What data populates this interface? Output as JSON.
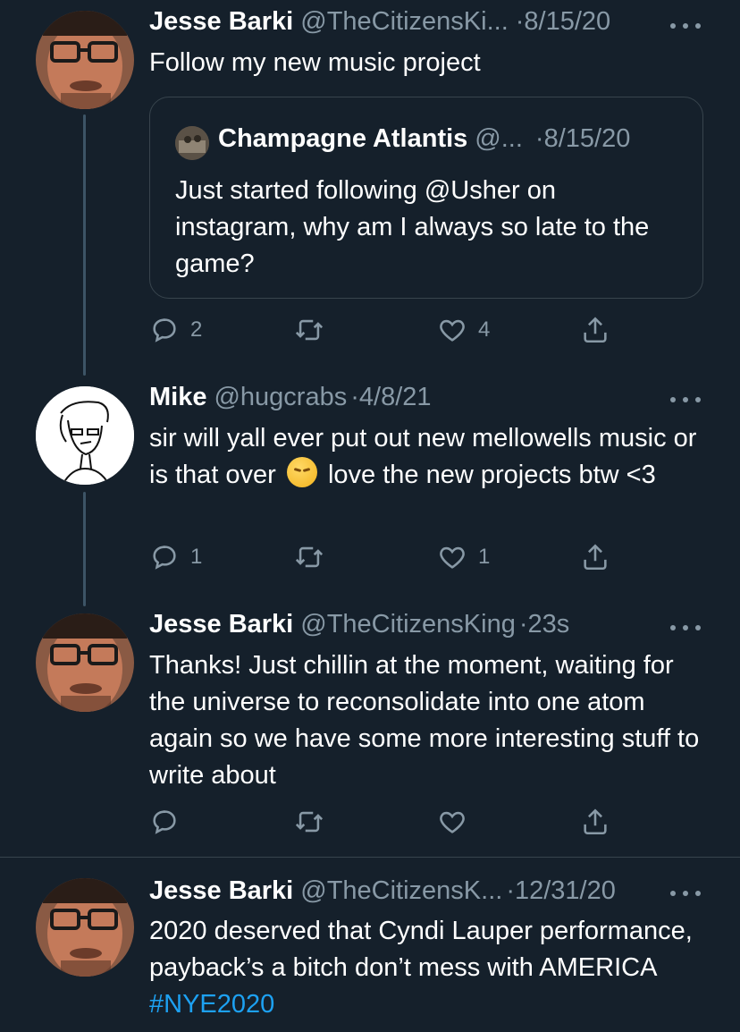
{
  "tweets": [
    {
      "name": "Jesse Barki",
      "handle": "@TheCitizensKi...",
      "date": "·8/15/20",
      "text": "Follow my new music project",
      "quote": {
        "name": "Champagne Atlantis",
        "handle": "@...",
        "date": "·8/15/20",
        "text": "Just started following @Usher on instagram, why am I always so late to the game?"
      },
      "replies": "2",
      "retweets": "",
      "likes": "4"
    },
    {
      "name": "Mike",
      "handle": "@hugcrabs",
      "date": "·4/8/21",
      "text_before_emoji": "sir will yall ever put out new mellowells music or is that over",
      "emoji": "pensive-face",
      "text_after_emoji": "love the new projects btw <3",
      "replies": "1",
      "retweets": "",
      "likes": "1"
    },
    {
      "name": "Jesse Barki",
      "handle": "@TheCitizensKing",
      "date": "·23s",
      "text": "Thanks! Just chillin at the moment, waiting for the universe to reconsolidate into one atom again so we have some more interesting stuff to write about",
      "replies": "",
      "retweets": "",
      "likes": ""
    },
    {
      "name": "Jesse Barki",
      "handle": "@TheCitizensK...",
      "date": "·12/31/20",
      "text": "2020 deserved that Cyndi Lauper performance, payback’s a bitch don’t mess with AMERICA",
      "hashtag": "#NYE2020"
    }
  ],
  "icons": {
    "reply": "reply-icon",
    "retweet": "retweet-icon",
    "like": "heart-icon",
    "share": "share-icon",
    "more": "more-icon"
  },
  "colors": {
    "background": "#15202b",
    "secondary_text": "#8899a6",
    "link": "#1da1f2",
    "border": "#38444d"
  }
}
